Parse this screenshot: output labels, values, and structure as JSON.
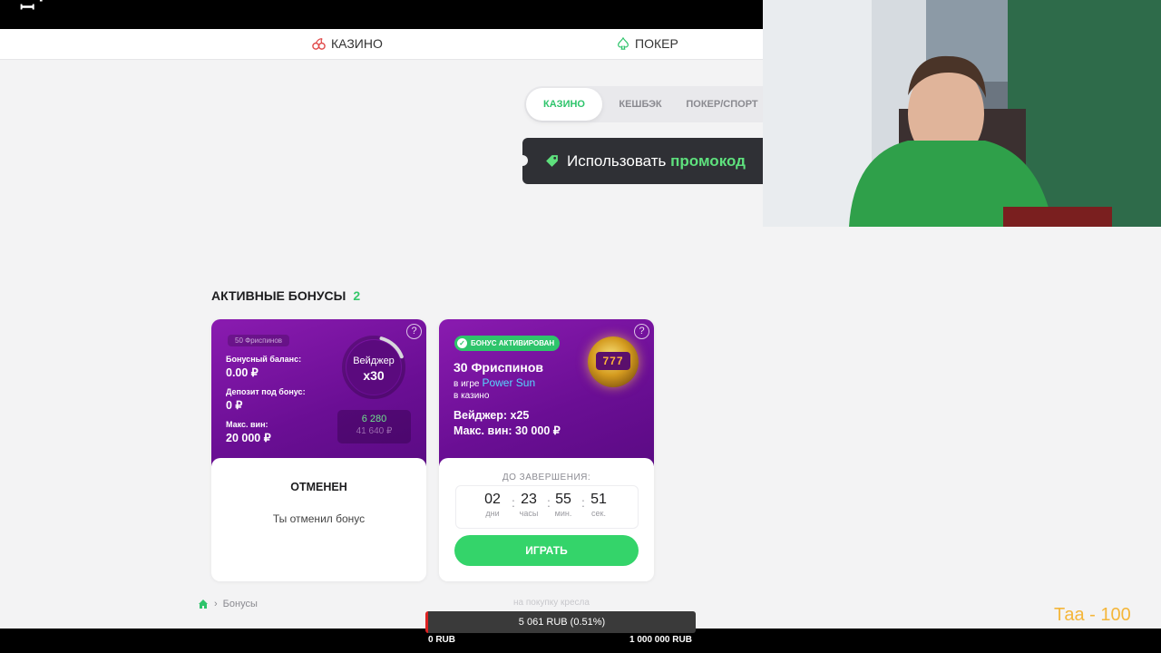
{
  "nav": {
    "casino_label": "КАЗИНО",
    "poker_label": "ПОКЕР"
  },
  "tabs": [
    {
      "label": "КАЗИНО",
      "active": true
    },
    {
      "label": "КЕШБЭК",
      "active": false
    },
    {
      "label": "ПОКЕР/СПОРТ",
      "active": false
    }
  ],
  "promo": {
    "text": "Использовать",
    "accent": "промокод"
  },
  "section": {
    "title": "АКТИВНЫЕ БОНУСЫ",
    "count": "2"
  },
  "card1": {
    "freespins_chip": "50 Фриспинов",
    "balance_label": "Бонусный баланс:",
    "balance_value": "0.00 ₽",
    "deposit_label": "Депозит под бонус:",
    "deposit_value": "0 ₽",
    "maxwin_label": "Макс. вин:",
    "maxwin_value": "20 000 ₽",
    "wager_label": "Вейджер",
    "wager_value": "x30",
    "wager_progress": 0.15,
    "progress_current": "6 280",
    "progress_total": "41 640 ₽",
    "status_title": "ОТМЕНЕН",
    "status_text": "Ты отменил бонус"
  },
  "card2": {
    "badge": "БОНУС АКТИВИРОВАН",
    "title": "30 Фриспинов",
    "game_prefix": "в игре",
    "game_name": "Power Sun",
    "place": "в казино",
    "wager": "Вейджер: x25",
    "maxwin": "Макс. вин: 30 000 ₽",
    "slot_icon": "777",
    "until_label": "ДО ЗАВЕРШЕНИЯ:",
    "timer": [
      {
        "value": "02",
        "unit": "дни"
      },
      {
        "value": "23",
        "unit": "часы"
      },
      {
        "value": "55",
        "unit": "мин."
      },
      {
        "value": "51",
        "unit": "сек."
      }
    ],
    "play_label": "ИГРАТЬ"
  },
  "breadcrumb": {
    "current": "Бонусы"
  },
  "stream": {
    "progress_text": "5 061 RUB (0.51%)",
    "progress_fraction": 0.0051,
    "min_label": "0 RUB",
    "max_label": "1 000 000 RUB",
    "faded_text": "на покупку кресла",
    "overlay_text": "Таа - 100"
  },
  "colors": {
    "accent_green": "#2ec46b",
    "card_purple": "#7a14a4",
    "promo_bg": "#2f3035",
    "overlay_orange": "#f4b63a"
  }
}
